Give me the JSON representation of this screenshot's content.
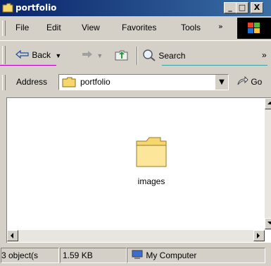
{
  "window": {
    "title": "portfolio",
    "controls": {
      "minimize": "_",
      "maximize": "□",
      "close": "X"
    }
  },
  "menu": {
    "items": [
      "File",
      "Edit",
      "View",
      "Favorites",
      "Tools"
    ],
    "more": "»"
  },
  "toolbar": {
    "back_label": "Back",
    "search_label": "Search",
    "more": "»"
  },
  "address": {
    "label": "Address",
    "value": "portfolio",
    "go_label": "Go"
  },
  "content": {
    "items": [
      {
        "name": "images",
        "icon": "folder-icon"
      }
    ]
  },
  "status": {
    "objects": "3 object(s",
    "size": "1.59 KB",
    "location": "My Computer"
  },
  "colors": {
    "title_start": "#0a246a",
    "title_end": "#3a6ea5",
    "chrome": "#d4d0c8",
    "pane": "#ffffff"
  }
}
